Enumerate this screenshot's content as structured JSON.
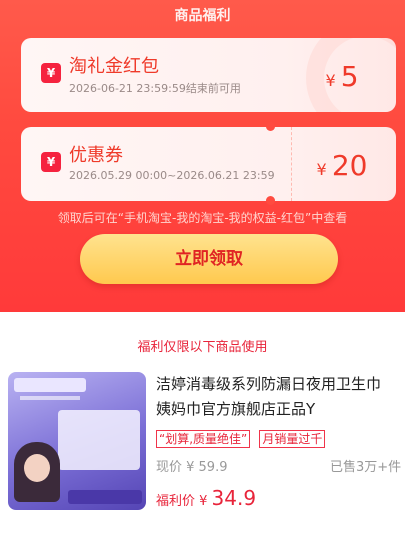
{
  "header": {
    "title": "商品福利"
  },
  "coupons": [
    {
      "title": "淘礼金红包",
      "subtitle": "2026-06-21 23:59:59结束前可用",
      "currency": "¥",
      "amount": "5",
      "icon": "red-packet-icon"
    },
    {
      "title": "优惠券",
      "subtitle": "2026.05.29 00:00~2026.06.21 23:59",
      "currency": "¥",
      "amount": "20",
      "icon": "coupon-icon"
    }
  ],
  "notice": "领取后可在“手机淘宝-我的淘宝-我的权益-红包”中查看",
  "claim_button": "立即领取",
  "limit_text": "福利仅限以下商品使用",
  "product": {
    "name_line1": "洁婷消毒级系列防漏日夜用卫生巾",
    "name_line2": "姨妈巾官方旗舰店正品Y",
    "tags": [
      "“划算,质量绝佳”",
      "月销量过千"
    ],
    "price_label": "现价 ¥ 59.9",
    "sold": "已售3万+件",
    "fuli_label": "福利价 ¥ ",
    "fuli_price": "34.9"
  },
  "colors": {
    "brand_red": "#ff4b40",
    "accent": "#ef3a2a",
    "button": "#ffc94e"
  }
}
